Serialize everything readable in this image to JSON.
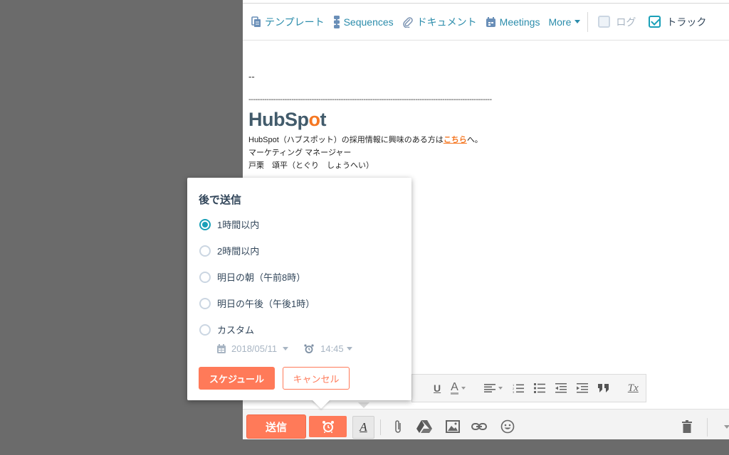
{
  "toolbar": {
    "items": [
      {
        "label": "テンプレート",
        "icon": "templates-icon"
      },
      {
        "label": "Sequences",
        "icon": "sequences-icon"
      },
      {
        "label": "ドキュメント",
        "icon": "paperclip-icon"
      },
      {
        "label": "Meetings",
        "icon": "calendar-icon"
      }
    ],
    "more_label": "More",
    "log_label": "ログ",
    "log_checked": false,
    "track_label": "トラック",
    "track_checked": true
  },
  "email_body": {
    "dash": "--",
    "rule": "------------------------------------------------------------------------------------------------------------",
    "logo_text_a": "HubSp",
    "logo_text_o": "o",
    "logo_text_b": "t",
    "line1_prefix": "HubSpot（ハブスポット）の採用情報に興味のある方は",
    "line1_link": "こちら",
    "line1_suffix": "へ。",
    "line2": "マーケティング マネージャー",
    "line3": "戸栗　頌平（とぐり　しょうへい）"
  },
  "schedule_popover": {
    "title": "後で送信",
    "options": [
      {
        "label": "1時間以内",
        "selected": true
      },
      {
        "label": "2時間以内",
        "selected": false
      },
      {
        "label": "明日の朝（午前8時）",
        "selected": false
      },
      {
        "label": "明日の午後（午後1時）",
        "selected": false
      },
      {
        "label": "カスタム",
        "selected": false
      }
    ],
    "custom_date": "2018/05/11",
    "custom_time": "14:45",
    "schedule_button": "スケジュール",
    "cancel_button": "キャンセル"
  },
  "format_toolbar": {
    "underline": "U",
    "font_color": "A",
    "clear_format": "Tx"
  },
  "bottom_bar": {
    "send_label": "送信",
    "format_toggle_label": "A"
  },
  "colors": {
    "accent_orange": "#ff7a59",
    "link_teal": "#2b8cab",
    "radio_selected": "#1aa0b8",
    "text_dark": "#33475b",
    "hubspot_logo_orange": "#f57722"
  }
}
